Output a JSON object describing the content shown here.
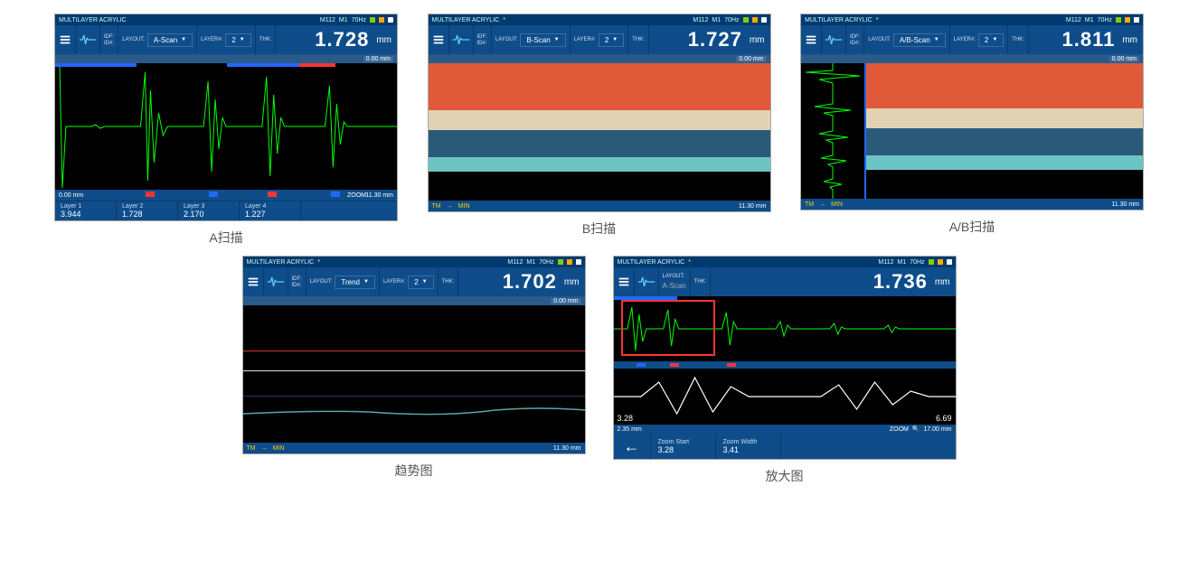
{
  "common": {
    "title": "MULTILAYER ACRYLIC",
    "status_m": "M112",
    "status_m1": "M1",
    "status_hz": "70Hz",
    "idf_label": "IDF:",
    "idn_label": "ID#:",
    "layout_label": "LAYOUT:",
    "layer_label": "LAYER#:",
    "layer_num": "2",
    "thk_label": "THK:",
    "unit": "mm",
    "zoom_label": "ZOOM",
    "range_start": "0.00 mm",
    "range_end": "11.30 mm",
    "tm_label": "TM",
    "min_label": "MIN"
  },
  "ascan": {
    "caption": "A扫描",
    "layout": "A-Scan",
    "thk": "1.728",
    "sub_right": "0.00 mm",
    "layers": [
      {
        "name": "Layer 1",
        "val": "3.944"
      },
      {
        "name": "Layer 2",
        "val": "1.728"
      },
      {
        "name": "Layer 3",
        "val": "2.170"
      },
      {
        "name": "Layer 4",
        "val": "1.227"
      }
    ]
  },
  "bscan": {
    "caption": "B扫描",
    "layout": "B-Scan",
    "thk": "1.727",
    "sub_right": "0.00 mm"
  },
  "abscan": {
    "caption": "A/B扫描",
    "layout": "A/B-Scan",
    "thk": "1.811",
    "sub_right": "0.00 mm"
  },
  "trend": {
    "caption": "趋势图",
    "layout": "Trend",
    "thk": "1.702",
    "sub_right": "0.00 mm"
  },
  "zoom": {
    "caption": "放大图",
    "layout": "A-Scan",
    "thk": "1.736",
    "left_val": "3.28",
    "right_val": "6.69",
    "bar_left": "2.35 mm",
    "bar_right": "17.00 mm",
    "zoom_start_label": "Zoom Start",
    "zoom_start_val": "3.28",
    "zoom_width_label": "Zoom Width",
    "zoom_width_val": "3.41"
  }
}
